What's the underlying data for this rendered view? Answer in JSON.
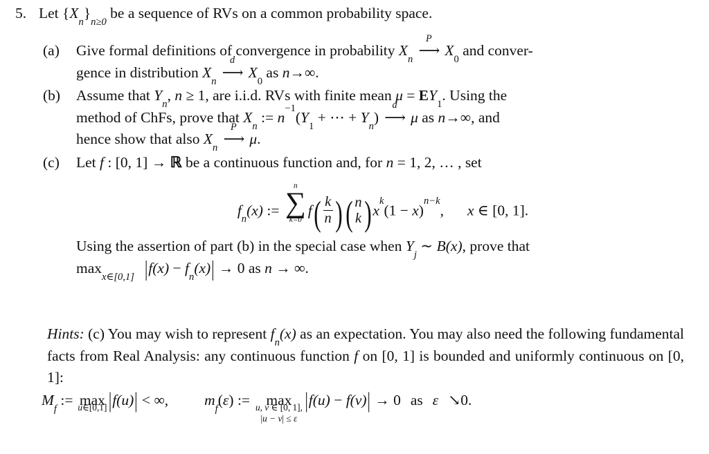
{
  "document": {
    "type": "probability-theory-exercise",
    "background_color": "#ffffff",
    "text_color": "#111111"
  },
  "problem": {
    "number": "5.",
    "stem_prefix": "Let ",
    "stem_seq_open": "{",
    "stem_seq_var": "X",
    "stem_seq_var_sub": "n",
    "stem_seq_close": "}",
    "stem_seq_index": "n≥0",
    "stem_suffix": " be a sequence of RVs on a common probability space."
  },
  "parts": [
    {
      "label": "(a)",
      "text_1": "Give formal definitions of convergence in probability ",
      "var_xn": "X",
      "var_xn_sub": "n",
      "arrow_label": "P",
      "var_x0": "X",
      "var_x0_sub": "0",
      "text_2": " and conver-",
      "text_3": "gence in distribution ",
      "arrow_label_2": "d",
      "text_4": " as ",
      "var_n": "n",
      "arrow_plain": "→",
      "infinity": "∞",
      "period": "."
    },
    {
      "label": "(b)",
      "text_1": "Assume that ",
      "var_y": "Y",
      "var_y_sub": "n",
      "text_2": ", ",
      "var_n": "n",
      "text_ge": " ≥ 1, are i.i.d. RVs with finite mean ",
      "mu": "μ",
      "equals": " = ",
      "bold_e": "E",
      "var_y1": "Y",
      "var_y1_sub": "1",
      "text_3": ".  Using the",
      "text_4": "method of ChFs, prove that ",
      "var_xn": "X",
      "var_xn_sub": "n",
      "assign": " := ",
      "n_pow": "n",
      "n_pow_sup": "−1",
      "paren_open": "(",
      "y1": "Y",
      "y1_sub": "1",
      "plus": " + ",
      "cdots": "⋯",
      "plus_2": " + ",
      "yn": "Y",
      "yn_sub": "n",
      "paren_close": ")",
      "arrow_label": "d",
      "text_5": " as ",
      "text_6": ", and",
      "text_7": "hence show that also ",
      "arrow_label_2": "P",
      "text_8": "."
    },
    {
      "label": "(c)",
      "text_1": "Let ",
      "var_f": "f",
      "colon": " : ",
      "interval": "[0, 1]",
      "arrow": " → ",
      "reals": "ℝ",
      "text_2": " be a continuous function and, for ",
      "var_n": "n",
      "text_3": " = 1, 2, … , set",
      "text_after_1": "Using the assertion of part (b) in the special case when ",
      "var_yj": "Y",
      "var_yj_sub": "j",
      "sim": " ∼ ",
      "var_b": "B",
      "var_b_arg": "(x)",
      "text_after_2": ", prove that",
      "max_op": "max",
      "max_sub": "x∈[0,1]",
      "abs_open": "|",
      "fx": "f(x)",
      "minus": " − ",
      "fnx": "f",
      "fnx_sub": "n",
      "fnx_arg": "(x)",
      "abs_close": "|",
      "to_zero": " → 0 as ",
      "n_to_inf": "n → ∞",
      "period": "."
    }
  ],
  "display_equation": {
    "lhs_f": "f",
    "lhs_f_sub": "n",
    "lhs_arg": "(x)",
    "assign": " := ",
    "sum_symbol": "∑",
    "sum_upper": "n",
    "sum_lower": "k=0",
    "func_f": "f",
    "frac_num": "k",
    "frac_den": "n",
    "binom_top": "n",
    "binom_bottom": "k",
    "x_base": "x",
    "x_sup": "k",
    "term_open": "(1 − ",
    "term_var": "x",
    "term_close": ")",
    "term_sup": "n−k",
    "comma": ",",
    "domain_var": "x",
    "domain_in": " ∈ ",
    "domain_set": "[0, 1]",
    "period": "."
  },
  "hints": {
    "label": "Hints:",
    "text_1": " (c) You may wish to represent ",
    "fn": "f",
    "fn_sub": "n",
    "fn_arg": "(x)",
    "text_2": " as an expectation.  You may also need the following fundamental facts from Real Analysis: any continuous function ",
    "var_f": "f",
    "text_3": " on ",
    "interval_1": "[0, 1]",
    "text_4": " is bounded and uniformly continuous on ",
    "interval_2": "[0, 1]",
    "colon": ":"
  },
  "final_equation": {
    "m_symbol": "M",
    "m_sub": "f",
    "assign_1": " := ",
    "max_1": "max",
    "max_1_sub_var": "u",
    "max_1_sub_rest": "∈[0,1]",
    "abs_1_open": "|",
    "abs_1_body": "f(u)",
    "abs_1_close": "|",
    "less_than": " < ",
    "infinity": "∞",
    "comma": ",",
    "m_lower": "m",
    "m_lower_sub": "f",
    "eps_arg_open": "(",
    "epsilon": "ε",
    "eps_arg_close": ")",
    "assign_2": " := ",
    "max_2": "max",
    "max_2_line1_vars": "u, v",
    "max_2_line1_rest": " ∈ [0, 1],",
    "max_2_line2_open": "|",
    "max_2_line2_vars": "u − v",
    "max_2_line2_close": "|",
    "max_2_line2_rest": " ≤ ",
    "max_2_line2_eps": "ε",
    "abs_2_open": "|",
    "abs_2_fu": "f(u)",
    "abs_2_minus": " − ",
    "abs_2_fv": "f(v)",
    "abs_2_close": "|",
    "arrow_zero": " → 0",
    "as_text": "as",
    "epsilon_2": "ε",
    "searrow": "↘",
    "zero_period": "0."
  }
}
